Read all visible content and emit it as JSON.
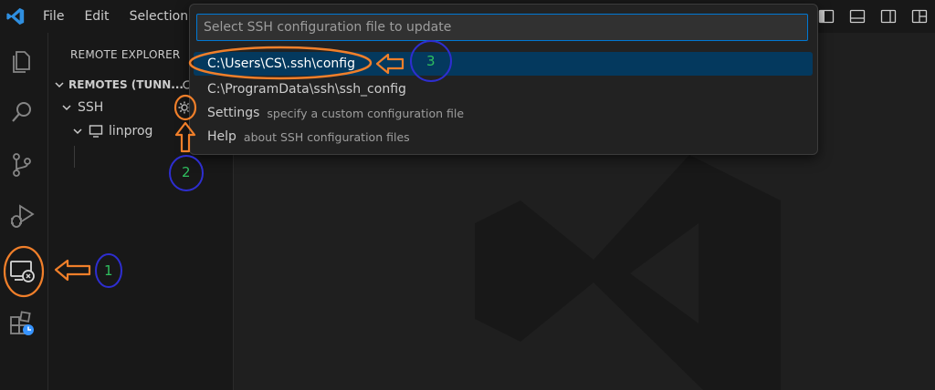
{
  "menu": {
    "file": "File",
    "edit": "Edit",
    "selection": "Selection"
  },
  "sidebar": {
    "title": "REMOTE EXPLORER",
    "section": "REMOTES (TUNN...",
    "ssh_label": "SSH",
    "host_label": "linprog"
  },
  "quickpick": {
    "placeholder": "Select SSH configuration file to update",
    "items": [
      {
        "label": "C:\\Users\\CS\\.ssh\\config",
        "description": ""
      },
      {
        "label": "C:\\ProgramData\\ssh\\ssh_config",
        "description": ""
      },
      {
        "label": "Settings",
        "description": "specify a custom configuration file"
      },
      {
        "label": "Help",
        "description": "about SSH configuration files"
      }
    ]
  },
  "annotations": {
    "step1": "1",
    "step2": "2",
    "step3": "3"
  },
  "colors": {
    "accent": "#0078d4",
    "selection": "#04395e",
    "highlight": "#f07f2a",
    "step_circle": "#2e2ed0",
    "step_number": "#2fbf5f"
  }
}
